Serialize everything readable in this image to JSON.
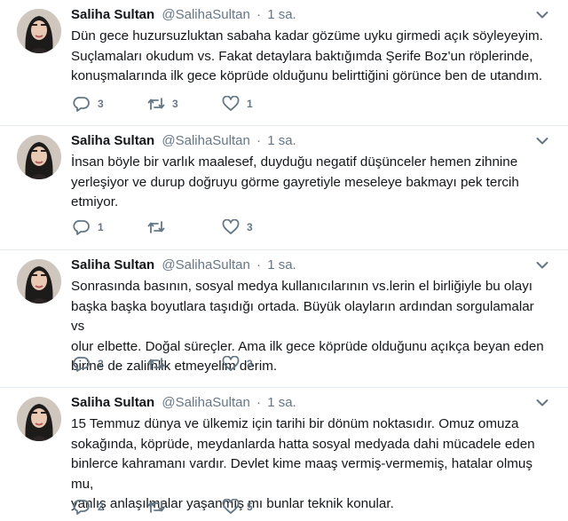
{
  "tweets": [
    {
      "name": "Saliha Sultan",
      "handle": "@SalihaSultan",
      "separator": "·",
      "time": "1 sa.",
      "text": "Dün gece huzursuzluktan sabaha kadar gözüme uyku girmedi açık söyleyeyim.\nSuçlamaları okudum vs. Fakat detaylara baktığımda Şerife Boz'un röplerinde,\nkonuşmalarında ilk gece köprüde olduğunu belirttiğini görünce ben de utandım.",
      "replies": "3",
      "retweets": "3",
      "likes": "1"
    },
    {
      "name": "Saliha Sultan",
      "handle": "@SalihaSultan",
      "separator": "·",
      "time": "1 sa.",
      "text": "İnsan böyle bir varlık maalesef, duyduğu negatif düşünceler hemen zihnine\nyerleşiyor ve durup doğruyu görme gayretiyle meseleye bakmayı pek tercih\netmiyor.",
      "replies": "1",
      "retweets": "",
      "likes": "3"
    },
    {
      "name": "Saliha Sultan",
      "handle": "@SalihaSultan",
      "separator": "·",
      "time": "1 sa.",
      "text": "Sonrasında basının, sosyal medya kullanıcılarının vs.lerin el birliğiyle bu olayı\nbaşka başka boyutlara taşıdığı ortada. Büyük olayların ardından sorgulamalar vs\nolur elbette. Doğal süreçler. Ama ilk gece köprüde olduğunu açıkça beyan eden\nbirine de zalimlik etmeyelim derim.",
      "replies": "2",
      "retweets": "",
      "likes": "3"
    },
    {
      "name": "Saliha Sultan",
      "handle": "@SalihaSultan",
      "separator": "·",
      "time": "1 sa.",
      "text": "15 Temmuz dünya ve ülkemiz için tarihi bir dönüm noktasıdır. Omuz omuza\nsokağında, köprüde, meydanlarda hatta sosyal medyada dahi mücadele eden\nbinlerce kahramanı vardır. Devlet kime maaş vermiş-vermemiş, hatalar olmuş mu,\nyanlış anlaşılmalar yaşanmış mı bunlar teknik konular.",
      "replies": "2",
      "retweets": "",
      "likes": "5"
    }
  ],
  "icons": {
    "reply": "reply-icon",
    "retweet": "retweet-icon",
    "like": "heart-icon",
    "menu": "chevron-down-icon"
  },
  "colors": {
    "text": "#14171a",
    "muted": "#657786",
    "divider": "#e6ecf0"
  }
}
